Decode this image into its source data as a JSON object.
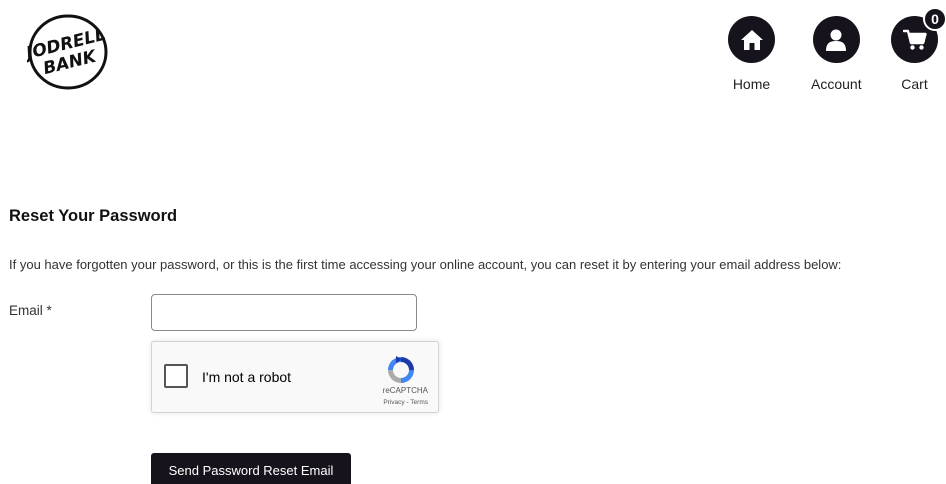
{
  "brand": {
    "logo_line1": "JODRELL",
    "logo_line2": "BANK"
  },
  "header": {
    "nav": [
      {
        "label": "Home",
        "icon": "home-icon"
      },
      {
        "label": "Account",
        "icon": "user-icon"
      },
      {
        "label": "Cart",
        "icon": "cart-icon",
        "badge": "0"
      }
    ]
  },
  "form": {
    "title": "Reset Your Password",
    "intro": "If you have forgotten your password, or this is the first time accessing your online account, you can reset it by entering your email address below:",
    "email_label": "Email *",
    "email_value": "",
    "submit_label": "Send Password Reset Email"
  },
  "recaptcha": {
    "label": "I'm not a robot",
    "brand": "reCAPTCHA",
    "links": "Privacy - Terms",
    "checked": false
  },
  "colors": {
    "accent": "#16131c",
    "background": "#ffffff"
  }
}
